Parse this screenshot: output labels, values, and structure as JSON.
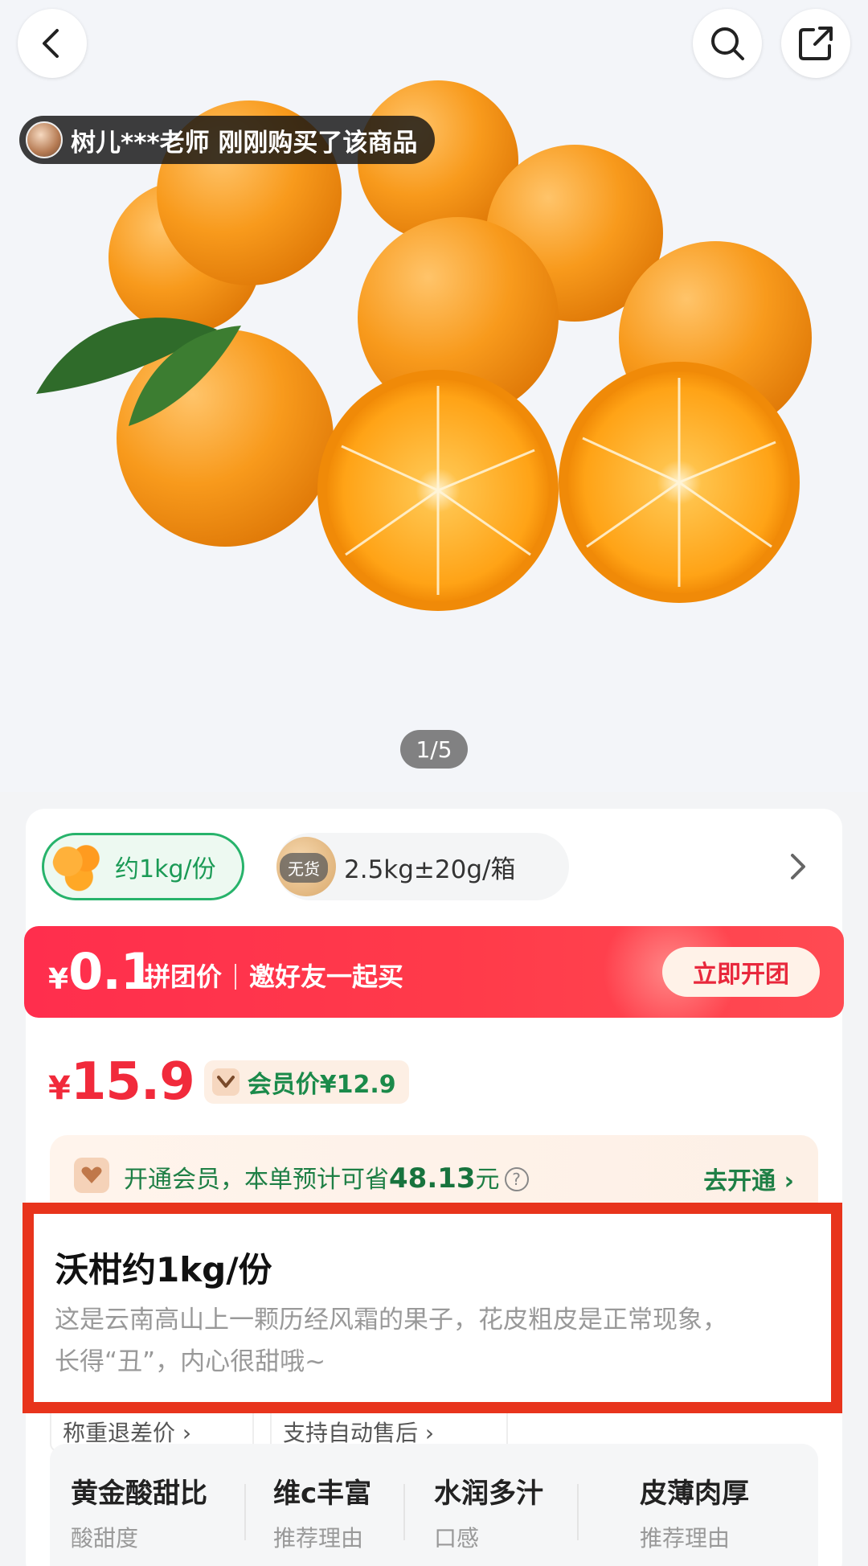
{
  "header": {
    "back_icon": "chevron-left-icon",
    "search_icon": "search-icon",
    "share_icon": "share-icon"
  },
  "gallery": {
    "recent_buyer": "树儿***老师 刚刚购买了该商品",
    "page_indicator": "1/5"
  },
  "specs": {
    "selected_label": "约1kg/份",
    "other_label": "2.5kg±20g/箱",
    "out_of_stock_badge": "无货"
  },
  "group_buy": {
    "currency": "¥",
    "price": "0.1",
    "label": "拼团价",
    "invite": "邀好友一起买",
    "button": "立即开团"
  },
  "price": {
    "currency": "¥",
    "value": "15.9",
    "member_price": "会员价¥12.9"
  },
  "membership": {
    "text_prefix": "开通会员，本单预计可省",
    "amount": "48.13",
    "unit": "元",
    "cta": "去开通 ›"
  },
  "product": {
    "title": "沃柑约1kg/份",
    "description_line1": "这是云南高山上一颗历经风霜的果子，花皮粗皮是正常现象，",
    "description_line2": "长得“丑”，内心很甜哦~"
  },
  "tags": [
    "称重退差价 ›",
    "支持自动售后 ›"
  ],
  "features": [
    {
      "title": "黄金酸甜比",
      "sub": "酸甜度"
    },
    {
      "title": "维c丰富",
      "sub": "推荐理由"
    },
    {
      "title": "水润多汁",
      "sub": "口感"
    },
    {
      "title": "皮薄肉厚",
      "sub": "推荐理由"
    }
  ],
  "colors": {
    "accent_green": "#27b36b",
    "price_red": "#f12a3b",
    "banner_red": "#ff2e4d",
    "highlight_red": "#e8341c"
  }
}
